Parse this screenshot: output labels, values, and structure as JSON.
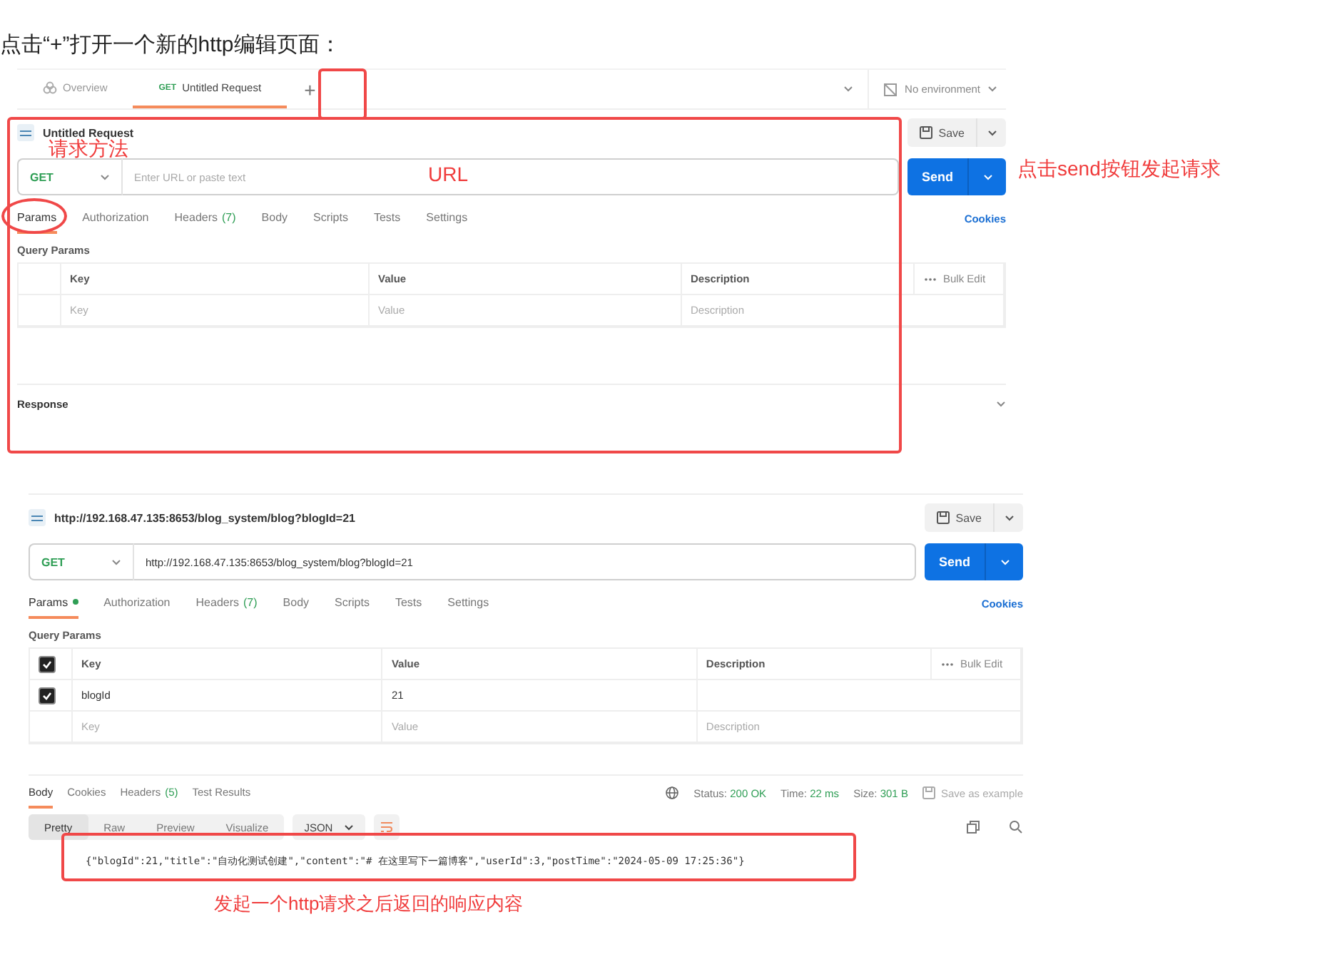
{
  "heading": "点击“+”打开一个新的http编辑页面：",
  "first": {
    "tabs": [
      {
        "label": "Overview",
        "selected": false
      },
      {
        "label": "Untitled Request",
        "method": "GET",
        "selected": true
      }
    ],
    "new_tab": "+",
    "environment": "No environment",
    "request_name": "Untitled Request",
    "save": "Save",
    "method": "GET",
    "url_placeholder": "Enter URL or paste text",
    "send": "Send",
    "request_tabs": [
      {
        "label": "Params",
        "dot": false,
        "selected": true
      },
      {
        "label": "Authorization",
        "dot": false,
        "selected": false
      },
      {
        "label": "Headers",
        "count": "(7)",
        "dot": false,
        "selected": false
      },
      {
        "label": "Body",
        "dot": false,
        "selected": false
      },
      {
        "label": "Scripts",
        "dot": false,
        "selected": false
      },
      {
        "label": "Tests",
        "dot": false,
        "selected": false
      },
      {
        "label": "Settings",
        "dot": false,
        "selected": false
      }
    ],
    "cookies": "Cookies",
    "section": "Query Params",
    "columns": [
      "Key",
      "Value",
      "Description"
    ],
    "bulk_edit": "Bulk Edit",
    "rows": [
      {
        "kind": "placeholder",
        "key": "Key",
        "value": "Value",
        "description": "Description"
      }
    ],
    "response": "Response"
  },
  "second": {
    "request_name": "http://192.168.47.135:8653/blog_system/blog?blogId=21",
    "save": "Save",
    "method": "GET",
    "url": "http://192.168.47.135:8653/blog_system/blog?blogId=21",
    "send": "Send",
    "request_tabs": [
      {
        "label": "Params",
        "dot": true,
        "selected": true
      },
      {
        "label": "Authorization",
        "dot": false,
        "selected": false
      },
      {
        "label": "Headers",
        "count": "(7)",
        "dot": false,
        "selected": false
      },
      {
        "label": "Body",
        "dot": false,
        "selected": false
      },
      {
        "label": "Scripts",
        "dot": false,
        "selected": false
      },
      {
        "label": "Tests",
        "dot": false,
        "selected": false
      },
      {
        "label": "Settings",
        "dot": false,
        "selected": false
      }
    ],
    "cookies": "Cookies",
    "section": "Query Params",
    "columns": [
      "Key",
      "Value",
      "Description"
    ],
    "bulk_edit": "Bulk Edit",
    "all_checked": true,
    "rows": [
      {
        "kind": "param",
        "checked": true,
        "key": "blogId",
        "value": "21"
      },
      {
        "kind": "placeholder",
        "key": "Key",
        "value": "Value",
        "description": "Description"
      }
    ],
    "response_panel": {
      "tabs": [
        {
          "label": "Body",
          "selected": true
        },
        {
          "label": "Cookies",
          "selected": false
        },
        {
          "label": "Headers",
          "count": "(5)",
          "selected": false
        },
        {
          "label": "Test Results",
          "selected": false
        }
      ],
      "status_label": "Status:",
      "status": "200 OK",
      "time_label": "Time:",
      "time": "22 ms",
      "size_label": "Size:",
      "size": "301 B",
      "save_example": "Save as example",
      "views": [
        {
          "label": "Pretty",
          "selected": true
        },
        {
          "label": "Raw",
          "selected": false
        },
        {
          "label": "Preview",
          "selected": false
        },
        {
          "label": "Visualize",
          "selected": false
        }
      ],
      "format": "JSON",
      "body": "{\"blogId\":21,\"title\":\"自动化测试创建\",\"content\":\"# 在这里写下一篇博客\",\"userId\":3,\"postTime\":\"2024-05-09 17:25:36\"}"
    }
  },
  "annotations": {
    "method": "请求方法",
    "url": "URL",
    "send": "点击send按钮发起请求",
    "response": "发起一个http请求之后返回的响应内容"
  }
}
